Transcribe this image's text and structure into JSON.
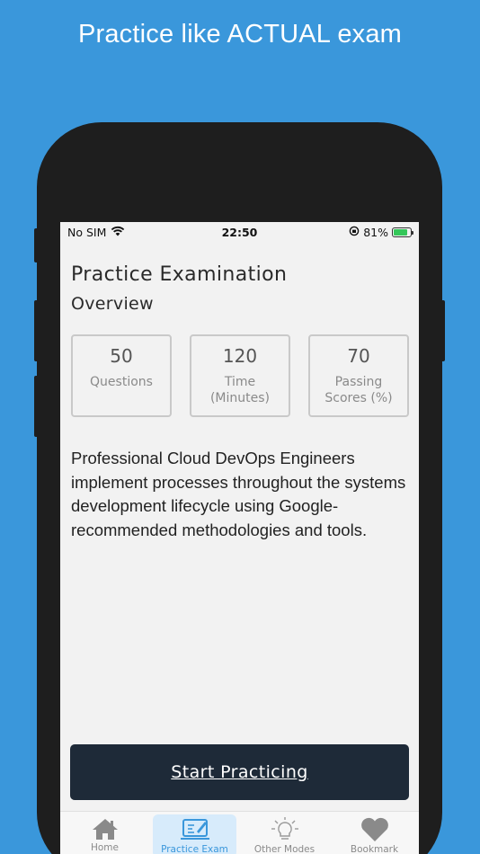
{
  "headline": "Practice like ACTUAL exam",
  "status_bar": {
    "carrier": "No SIM",
    "time": "22:50",
    "battery": "81%",
    "battery_level": 0.81
  },
  "screen": {
    "title": "Practice Examination",
    "subtitle": "Overview",
    "stats": [
      {
        "value": "50",
        "label": "Questions"
      },
      {
        "value": "120",
        "label": "Time (Minutes)"
      },
      {
        "value": "70",
        "label": "Passing Scores (%)"
      }
    ],
    "description": "Professional Cloud DevOps Engineers implement processes throughout the systems development lifecycle using Google-recommended methodologies and tools.",
    "start_button": "Start Practicing"
  },
  "tabs": [
    {
      "label": "Home",
      "icon": "home-icon"
    },
    {
      "label": "Practice Exam",
      "icon": "exam-icon",
      "active": true
    },
    {
      "label": "Other Modes",
      "icon": "lightbulb-icon"
    },
    {
      "label": "Bookmark",
      "icon": "heart-icon"
    }
  ],
  "colors": {
    "background": "#3a97db",
    "button": "#1e2a38",
    "active_tab": "#3a97db"
  }
}
